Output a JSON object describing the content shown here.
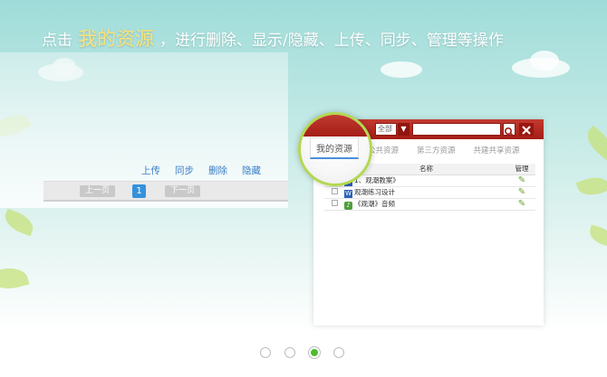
{
  "headline": {
    "prefix": "点击",
    "highlight": "我的资源",
    "suffix": "，进行删除、显示/隐藏、上传、同步、管理等操作"
  },
  "left_panel": {
    "actions": [
      "上传",
      "同步",
      "删除",
      "隐藏"
    ],
    "pager": {
      "prev": "上一页",
      "current": "1",
      "next": "下一页"
    }
  },
  "window": {
    "select_value": "全部",
    "active_tab": "我的资源",
    "tabs": [
      "公共资源",
      "第三方资源",
      "共建共享资源"
    ],
    "table": {
      "headers": {
        "name": "名称",
        "manage": "管理"
      },
      "rows": [
        {
          "icon": "word-icon",
          "name": "1、观潮教案》"
        },
        {
          "icon": "word-icon",
          "name": "观潮练习设计"
        },
        {
          "icon": "audio-icon",
          "name": "《观潮》音频"
        }
      ]
    }
  },
  "carousel": {
    "count": 4,
    "active": 3
  },
  "colors": {
    "accent_red": "#b3261e",
    "highlight_yellow": "#f9e27a",
    "link_blue": "#3a7dc7",
    "active_green": "#4cbc2e",
    "magnifier_ring": "#b3d850"
  }
}
